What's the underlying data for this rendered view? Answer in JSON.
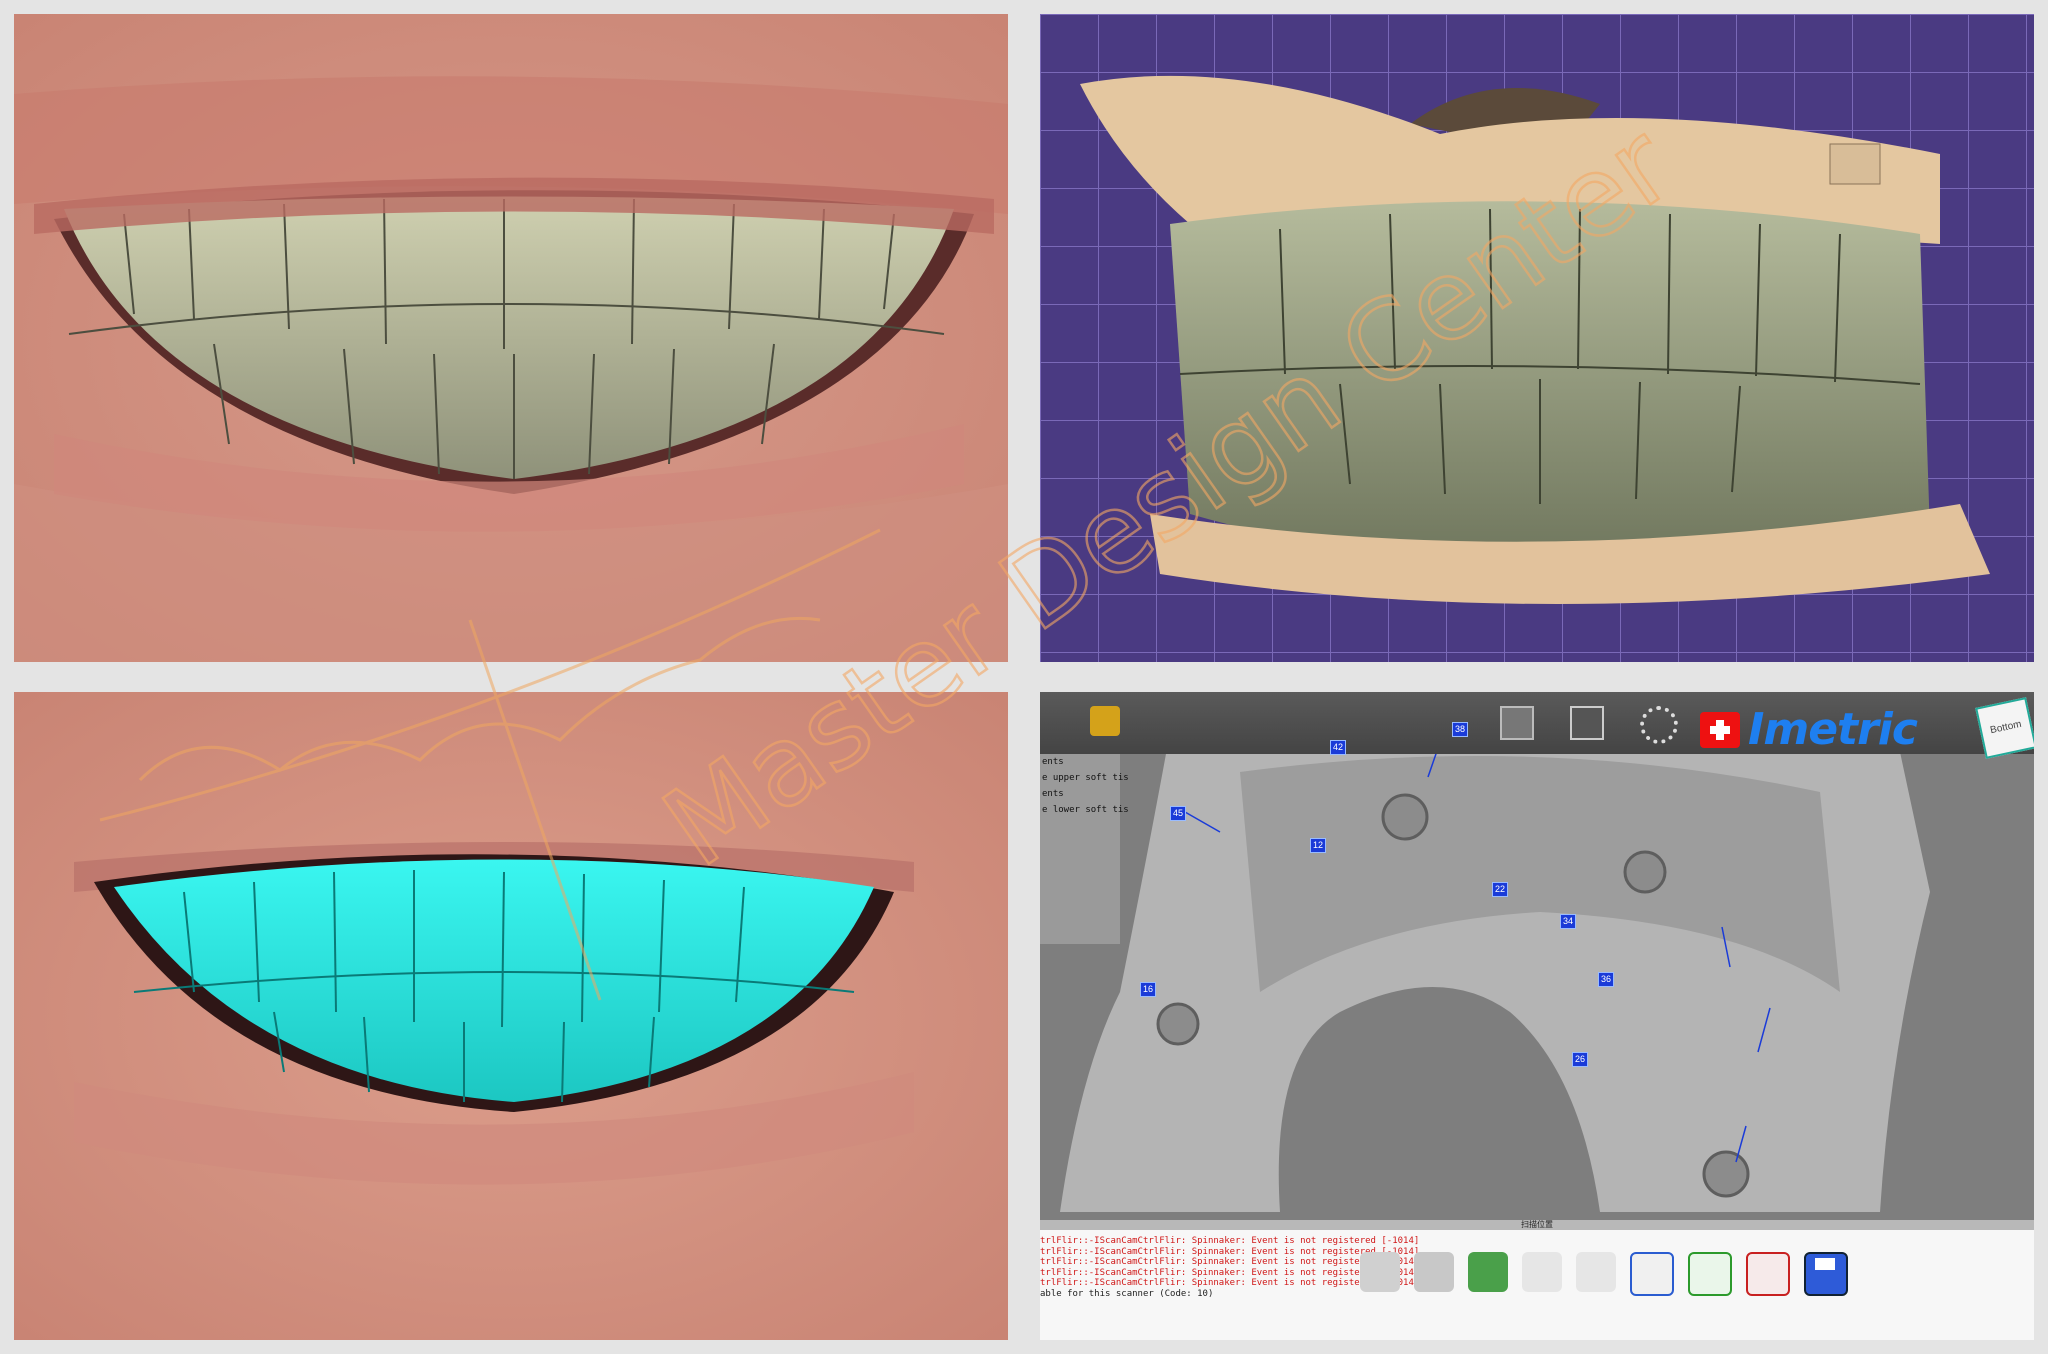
{
  "panel4": {
    "brand_text": "Imetric",
    "viewcube_label": "Bottom",
    "side_items": [
      "ents",
      "e upper soft tis",
      "ents",
      "e lower soft tis"
    ],
    "markers": [
      "42",
      "45",
      "12",
      "22",
      "34",
      "36",
      "16",
      "26",
      "38"
    ],
    "status_text": "扫描位置",
    "console_lines": [
      {
        "text": "trlFlir::-IScanCamCtrlFlir: Spinnaker: Event is not registered [-1014]",
        "type": "err"
      },
      {
        "text": "trlFlir::-IScanCamCtrlFlir: Spinnaker: Event is not registered [-1014]",
        "type": "err"
      },
      {
        "text": "trlFlir::-IScanCamCtrlFlir: Spinnaker: Event is not registered [-1014]",
        "type": "err"
      },
      {
        "text": "trlFlir::-IScanCamCtrlFlir: Spinnaker: Event is not registered [-1014]",
        "type": "err"
      },
      {
        "text": "trlFlir::-IScanCamCtrlFlir: Spinnaker: Event is not registered [-1014]",
        "type": "err"
      },
      {
        "text": "able for this scanner (Code: 10)",
        "type": "ok"
      }
    ],
    "toolbar_icons": [
      "mesh-icon",
      "teeth-scan-icon",
      "soft-tissue-icon",
      "implant-icon",
      "tray-icon",
      "scanbody-icon",
      "denture-icon",
      "scissors-icon",
      "align-icon",
      "transfer-icon",
      "undo-icon",
      "redo-icon",
      "axes-icon",
      "export-icon",
      "import-icon",
      "save-icon"
    ]
  },
  "watermark": {
    "text": "Master Design Center"
  }
}
